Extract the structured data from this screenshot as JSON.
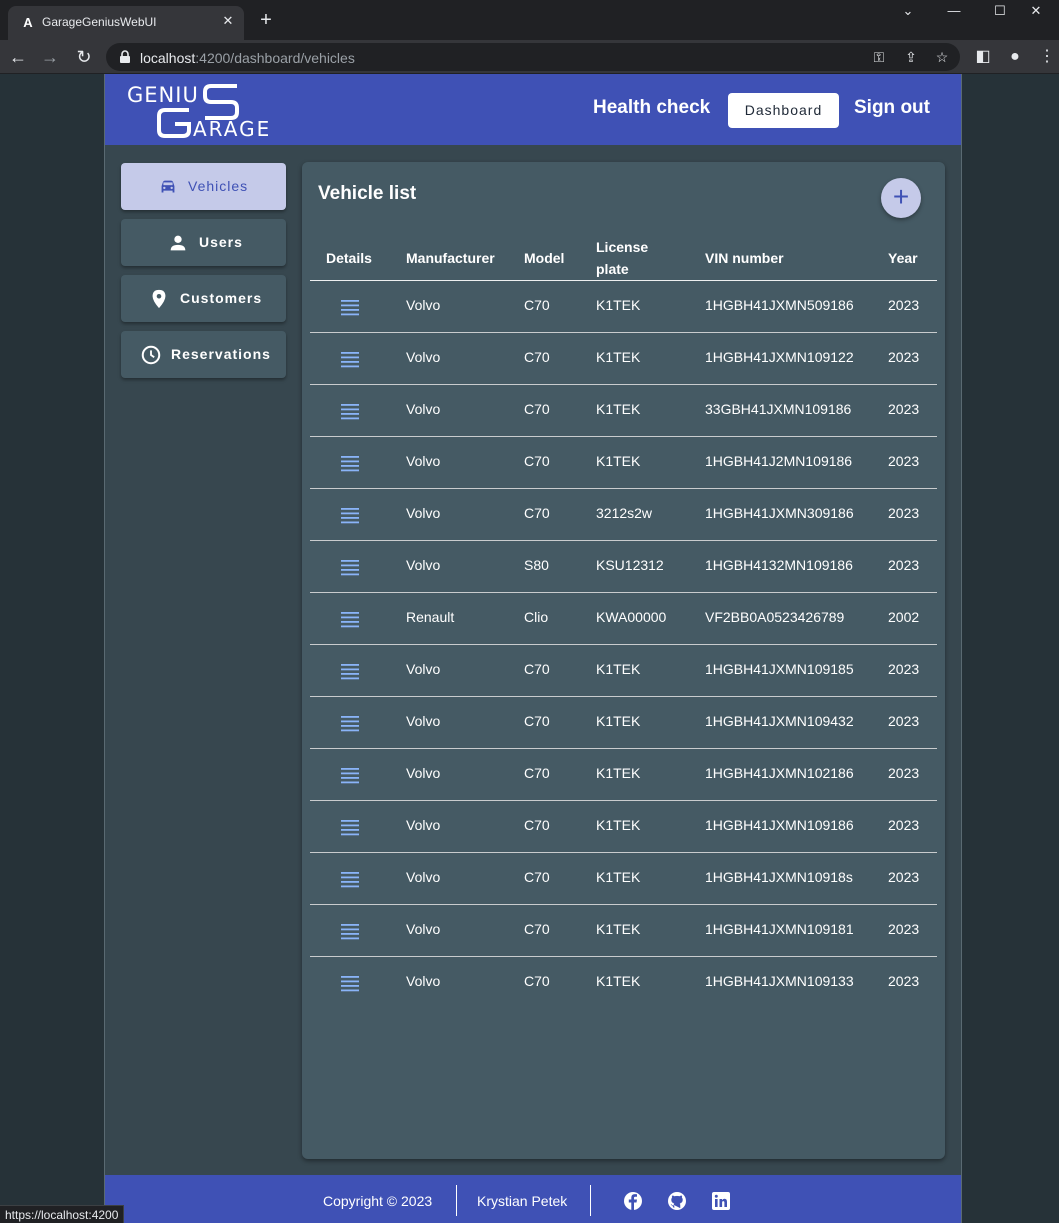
{
  "browser": {
    "tab_title": "GarageGeniusWebUI",
    "tab_favicon": "A",
    "url_host": "localhost",
    "url_rest": ":4200/dashboard/vehicles",
    "status_url": "https://localhost:4200"
  },
  "header": {
    "logo_alt": "GENIUS GARAGE",
    "health_check": "Health check",
    "dashboard": "Dashboard",
    "sign_out": "Sign out"
  },
  "sidenav": {
    "items": [
      {
        "label": "Vehicles",
        "icon": "car-icon",
        "active": true
      },
      {
        "label": "Users",
        "icon": "person-icon",
        "active": false
      },
      {
        "label": "Customers",
        "icon": "location-pin-icon",
        "active": false
      },
      {
        "label": "Reservations",
        "icon": "clock-icon",
        "active": false
      }
    ]
  },
  "vehicle_list": {
    "title": "Vehicle list",
    "add_label": "+",
    "columns": [
      "Details",
      "Manufacturer",
      "Model",
      "License plate",
      "VIN number",
      "Year"
    ],
    "rows": [
      {
        "manufacturer": "Volvo",
        "model": "C70",
        "plate": "K1TEK",
        "vin": "1HGBH41JXMN509186",
        "year": "2023"
      },
      {
        "manufacturer": "Volvo",
        "model": "C70",
        "plate": "K1TEK",
        "vin": "1HGBH41JXMN109122",
        "year": "2023"
      },
      {
        "manufacturer": "Volvo",
        "model": "C70",
        "plate": "K1TEK",
        "vin": "33GBH41JXMN109186",
        "year": "2023"
      },
      {
        "manufacturer": "Volvo",
        "model": "C70",
        "plate": "K1TEK",
        "vin": "1HGBH41J2MN109186",
        "year": "2023"
      },
      {
        "manufacturer": "Volvo",
        "model": "C70",
        "plate": "3212s2w",
        "vin": "1HGBH41JXMN309186",
        "year": "2023"
      },
      {
        "manufacturer": "Volvo",
        "model": "S80",
        "plate": "KSU12312",
        "vin": "1HGBH4132MN109186",
        "year": "2023"
      },
      {
        "manufacturer": "Renault",
        "model": "Clio",
        "plate": "KWA00000",
        "vin": "VF2BB0A0523426789",
        "year": "2002"
      },
      {
        "manufacturer": "Volvo",
        "model": "C70",
        "plate": "K1TEK",
        "vin": "1HGBH41JXMN109185",
        "year": "2023"
      },
      {
        "manufacturer": "Volvo",
        "model": "C70",
        "plate": "K1TEK",
        "vin": "1HGBH41JXMN109432",
        "year": "2023"
      },
      {
        "manufacturer": "Volvo",
        "model": "C70",
        "plate": "K1TEK",
        "vin": "1HGBH41JXMN102186",
        "year": "2023"
      },
      {
        "manufacturer": "Volvo",
        "model": "C70",
        "plate": "K1TEK",
        "vin": "1HGBH41JXMN109186",
        "year": "2023"
      },
      {
        "manufacturer": "Volvo",
        "model": "C70",
        "plate": "K1TEK",
        "vin": "1HGBH41JXMN10918s",
        "year": "2023"
      },
      {
        "manufacturer": "Volvo",
        "model": "C70",
        "plate": "K1TEK",
        "vin": "1HGBH41JXMN109181",
        "year": "2023"
      },
      {
        "manufacturer": "Volvo",
        "model": "C70",
        "plate": "K1TEK",
        "vin": "1HGBH41JXMN109133",
        "year": "2023"
      }
    ]
  },
  "footer": {
    "copyright": "Copyright © 2023",
    "author": "Krystian Petek",
    "social_icons": [
      "facebook-icon",
      "github-icon",
      "linkedin-icon"
    ]
  },
  "colors": {
    "primary": "#3f51b5",
    "primary_light": "#c5cae9",
    "background": "#37474f",
    "card": "#455a64",
    "details_icon": "#8ab4f8"
  }
}
